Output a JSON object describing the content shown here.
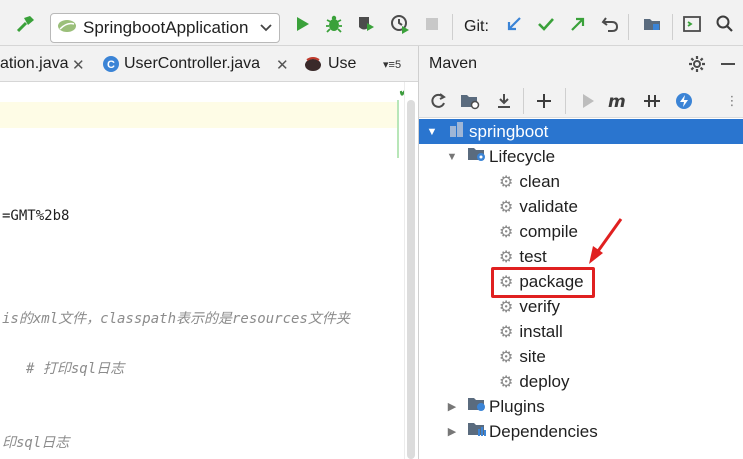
{
  "toolbar": {
    "run_config": "SpringbootApplication",
    "git_label": "Git:"
  },
  "tabs": [
    {
      "label": "ation.java"
    },
    {
      "label": "UserController.java"
    },
    {
      "label": "Use"
    }
  ],
  "tabs_overflow_count": "5",
  "editor": {
    "lines": [
      {
        "text": "=GMT%2b8"
      },
      {
        "text": "is的xml文件，classpath表示的是resources文件夹"
      },
      {
        "text": " # 打印sql日志"
      },
      {
        "text": "印sql日志"
      }
    ]
  },
  "maven": {
    "title": "Maven",
    "root": "springboot",
    "lifecycle_label": "Lifecycle",
    "phases": [
      "clean",
      "validate",
      "compile",
      "test",
      "package",
      "verify",
      "install",
      "site",
      "deploy"
    ],
    "plugins_label": "Plugins",
    "dependencies_label": "Dependencies",
    "highlighted_phase": "package"
  },
  "colors": {
    "selection": "#2a75cf",
    "annotation": "#e02020",
    "run_green": "#3aa13a",
    "git_blue": "#3b84d6"
  }
}
